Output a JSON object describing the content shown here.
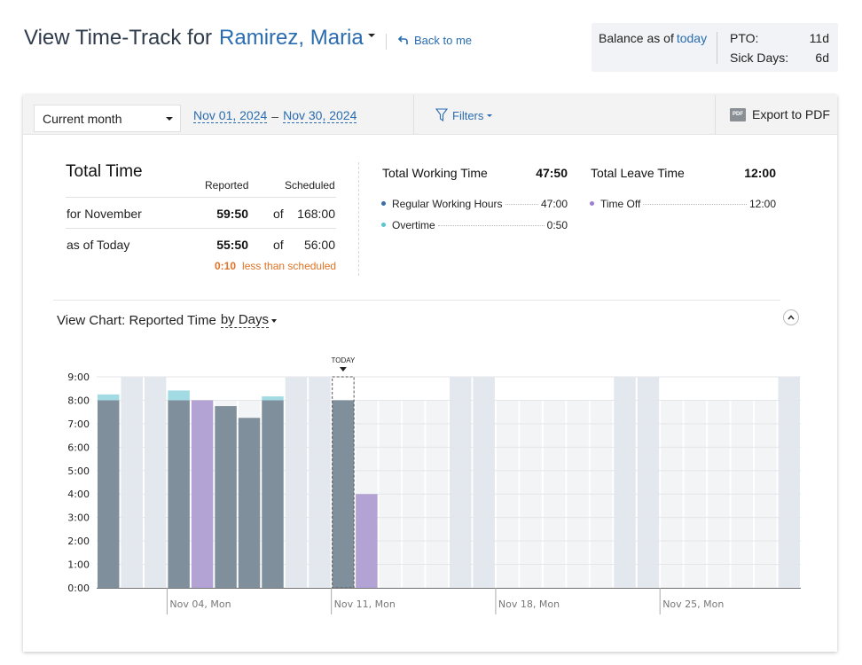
{
  "header": {
    "title_prefix": "View Time-Track for",
    "employee_name": "Ramirez, Maria",
    "back_link": "Back to me"
  },
  "balance": {
    "label": "Balance as of",
    "as_of_link": "today",
    "items": [
      {
        "label": "PTO:",
        "value": "11d"
      },
      {
        "label": "Sick Days:",
        "value": "6d"
      }
    ]
  },
  "toolbar": {
    "period_select": "Current month",
    "date_from": "Nov 01, 2024",
    "date_separator": "–",
    "date_to": "Nov 30, 2024",
    "filters_label": "Filters",
    "export_label": "Export to PDF",
    "export_icon_text": "PDF"
  },
  "total_time": {
    "title": "Total Time",
    "col_reported": "Reported",
    "col_scheduled": "Scheduled",
    "rows": [
      {
        "label": "for November",
        "reported": "59:50",
        "of": "of",
        "scheduled": "168:00"
      },
      {
        "label": "as of Today",
        "reported": "55:50",
        "of": "of",
        "scheduled": "56:00"
      }
    ],
    "difference_value": "0:10",
    "difference_text": "less than scheduled"
  },
  "working_time": {
    "title": "Total Working Time",
    "total": "47:50",
    "items": [
      {
        "label": "Regular Working Hours",
        "value": "47:00",
        "color": "#3a6ea5"
      },
      {
        "label": "Overtime",
        "value": "0:50",
        "color": "#5bc4d0"
      }
    ]
  },
  "leave_time": {
    "title": "Total Leave Time",
    "total": "12:00",
    "items": [
      {
        "label": "Time Off",
        "value": "12:00",
        "color": "#9b7fd0"
      }
    ]
  },
  "chart_header": {
    "prefix": "View Chart:",
    "metric": "Reported Time",
    "mode": "by Days"
  },
  "chart_data": {
    "type": "bar",
    "stacked": true,
    "title": "Reported Time by Days",
    "xlabel": "",
    "ylabel": "",
    "ylim": [
      0,
      9
    ],
    "y_ticks": [
      "0:00",
      "1:00",
      "2:00",
      "3:00",
      "4:00",
      "5:00",
      "6:00",
      "7:00",
      "8:00",
      "9:00"
    ],
    "x_tick_labels": [
      {
        "day": 4,
        "label": "Nov 04, Mon"
      },
      {
        "day": 11,
        "label": "Nov 11, Mon"
      },
      {
        "day": 18,
        "label": "Nov 18, Mon"
      },
      {
        "day": 25,
        "label": "Nov 25, Mon"
      }
    ],
    "today_label": "TODAY",
    "today_day": 11,
    "scheduled_hours_per_workday": 8,
    "weekend_days": [
      2,
      3,
      9,
      10,
      16,
      17,
      23,
      24,
      30
    ],
    "days": [
      1,
      2,
      3,
      4,
      5,
      6,
      7,
      8,
      9,
      10,
      11,
      12,
      13,
      14,
      15,
      16,
      17,
      18,
      19,
      20,
      21,
      22,
      23,
      24,
      25,
      26,
      27,
      28,
      29,
      30
    ],
    "series": [
      {
        "name": "Regular Working Hours",
        "color": "#7f8f9c",
        "values": [
          8,
          0,
          0,
          8,
          0,
          7.75,
          7.25,
          8,
          0,
          0,
          8,
          0,
          0,
          0,
          0,
          0,
          0,
          0,
          0,
          0,
          0,
          0,
          0,
          0,
          0,
          0,
          0,
          0,
          0,
          0
        ]
      },
      {
        "name": "Overtime",
        "color": "#a3dbe4",
        "values": [
          0.25,
          0,
          0,
          0.4167,
          0,
          0,
          0,
          0.1667,
          0,
          0,
          0,
          0,
          0,
          0,
          0,
          0,
          0,
          0,
          0,
          0,
          0,
          0,
          0,
          0,
          0,
          0,
          0,
          0,
          0,
          0
        ]
      },
      {
        "name": "Time Off",
        "color": "#b3a3d4",
        "values": [
          0,
          0,
          0,
          0,
          8,
          0,
          0,
          0,
          0,
          0,
          0,
          4,
          0,
          0,
          0,
          0,
          0,
          0,
          0,
          0,
          0,
          0,
          0,
          0,
          0,
          0,
          0,
          0,
          0,
          0
        ]
      }
    ],
    "grid": true
  }
}
